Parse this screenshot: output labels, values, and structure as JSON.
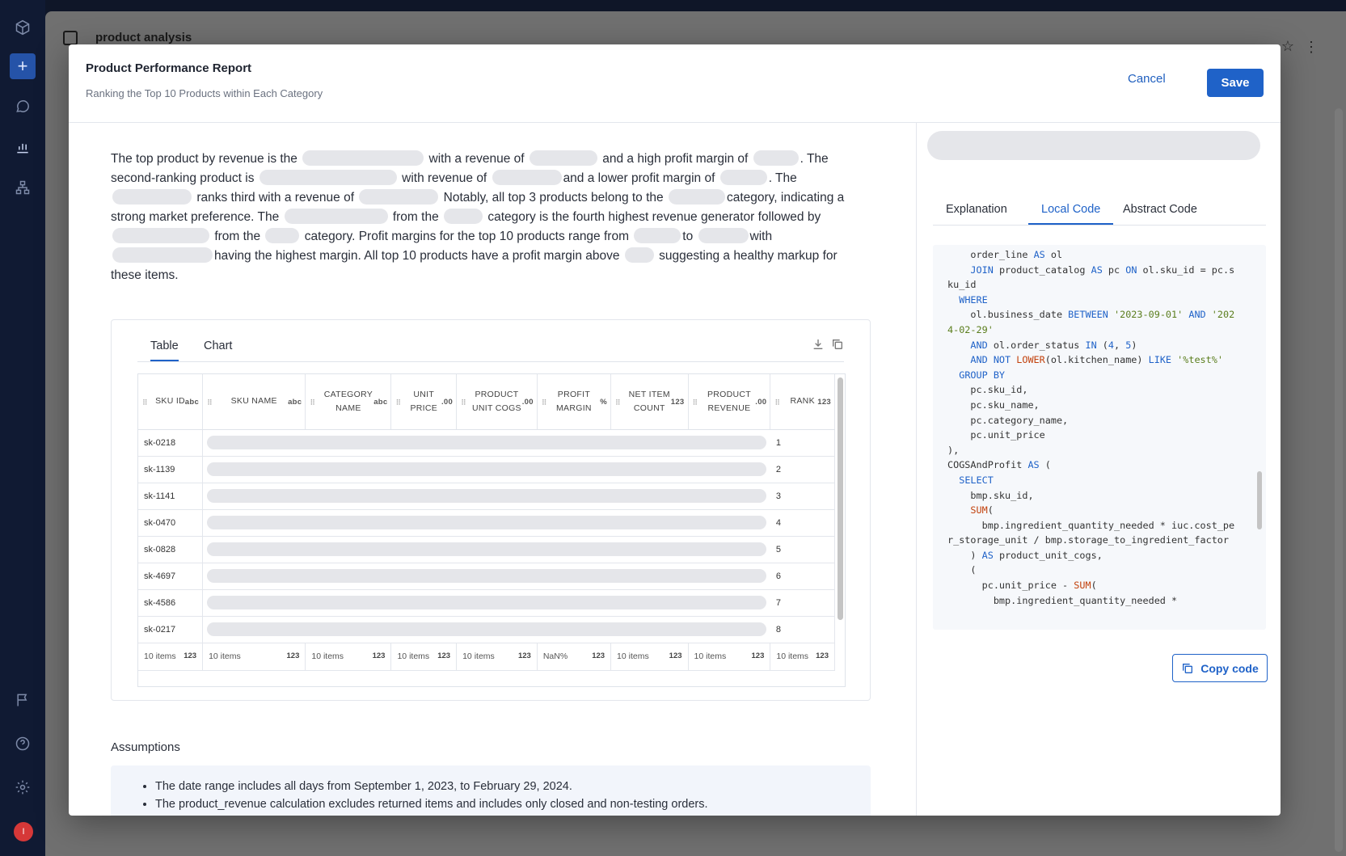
{
  "background_app": {
    "title": "product analysis"
  },
  "modal": {
    "title": "Product Performance Report",
    "subtitle": "Ranking the Top 10 Products within Each Category",
    "cancel_label": "Cancel",
    "save_label": "Save"
  },
  "summary": {
    "t1": "The top product by revenue is the",
    "t2": "with a revenue of",
    "t3": "and a high profit margin of",
    "t4": ". The second-ranking product is",
    "t5": "with revenue of",
    "t6": "and a lower profit margin of",
    "t7": ". The",
    "t8": "ranks third with a revenue of",
    "t9": "Notably, all top 3 products belong to the",
    "t10": "category, indicating a strong market preference. The",
    "t11": "from the",
    "t12": "category is the fourth highest revenue generator followed by",
    "t13": "from the",
    "t14": "category. Profit margins for the top 10 products range from",
    "t15": "to",
    "t16": "with",
    "t17": "having the highest margin. All top 10 products have a profit margin above",
    "t18": "suggesting a healthy markup for these items."
  },
  "table_card": {
    "tabs": [
      "Table",
      "Chart"
    ],
    "columns": [
      {
        "label": "SKU ID",
        "type": "abc"
      },
      {
        "label": "SKU NAME",
        "type": "abc"
      },
      {
        "label": "CATEGORY NAME",
        "type": "abc"
      },
      {
        "label": "UNIT PRICE",
        "type": ".00"
      },
      {
        "label": "PRODUCT UNIT COGS",
        "type": ".00"
      },
      {
        "label": "PROFIT MARGIN",
        "type": "%"
      },
      {
        "label": "NET ITEM COUNT",
        "type": "123"
      },
      {
        "label": "PRODUCT REVENUE",
        "type": ".00"
      },
      {
        "label": "RANK",
        "type": "123"
      }
    ],
    "rows": [
      {
        "sku": "sk-0218",
        "rank": "1"
      },
      {
        "sku": "sk-1139",
        "rank": "2"
      },
      {
        "sku": "sk-1141",
        "rank": "3"
      },
      {
        "sku": "sk-0470",
        "rank": "4"
      },
      {
        "sku": "sk-0828",
        "rank": "5"
      },
      {
        "sku": "sk-4697",
        "rank": "6"
      },
      {
        "sku": "sk-4586",
        "rank": "7"
      },
      {
        "sku": "sk-0217",
        "rank": "8"
      }
    ],
    "footer": [
      "10 items",
      "10 items",
      "10 items",
      "10 items",
      "10 items",
      "NaN%",
      "10 items",
      "10 items",
      "10 items"
    ],
    "footer_tag": "123"
  },
  "assumptions": {
    "heading": "Assumptions",
    "items": [
      "The date range includes all days from September 1, 2023, to February 29, 2024.",
      "The product_revenue calculation excludes returned items and includes only closed and non-testing orders."
    ]
  },
  "right_panel": {
    "tabs": [
      "Explanation",
      "Local Code",
      "Abstract Code"
    ],
    "active_tab": "Local Code",
    "copy_label": "Copy code"
  },
  "colors": {
    "accent": "#1f62c8",
    "redaction": "#e5e6ea"
  }
}
